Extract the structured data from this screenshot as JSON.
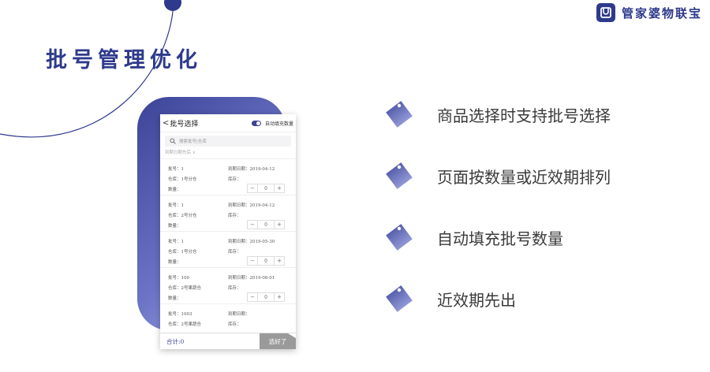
{
  "brand": {
    "name": "管家婆物联宝"
  },
  "slide": {
    "title": "批号管理优化"
  },
  "phone": {
    "header": {
      "back": "<",
      "title": "批号选择",
      "auto_fill_label": "自动填充数量",
      "auto_fill_on": true
    },
    "search": {
      "placeholder": "搜索批号|仓库"
    },
    "sort": {
      "label": "到期日期先后 ∨"
    },
    "items": [
      {
        "batch": "批号：1",
        "warehouse": "仓库：1号分仓",
        "qty_label": "数量：",
        "expiry": "到期日期：2019-04-12",
        "stock": "库存：",
        "qty": "0"
      },
      {
        "batch": "批号：1",
        "warehouse": "仓库：2号分仓",
        "qty_label": "数量：",
        "expiry": "到期日期：2019-04-12",
        "stock": "库存：",
        "qty": "0"
      },
      {
        "batch": "批号：1",
        "warehouse": "仓库：1号分仓",
        "qty_label": "数量：",
        "expiry": "到期日期：2019-05-30",
        "stock": "库存：",
        "qty": "0"
      },
      {
        "batch": "批号：100",
        "warehouse": "仓库：2号果蔬仓",
        "qty_label": "数量：",
        "expiry": "到期日期：2019-06-01",
        "stock": "库存：",
        "qty": "0"
      },
      {
        "batch": "批号：1003",
        "warehouse": "仓库：2号果蔬仓",
        "qty_label": "",
        "expiry": "到期日期：",
        "stock": "库存：",
        "qty": ""
      }
    ],
    "footer": {
      "total": "合计:0",
      "confirm": "选好了"
    }
  },
  "features": [
    {
      "text": "商品选择时支持批号选择",
      "icon": "diamond-tag-icon"
    },
    {
      "text": "页面按数量或近效期排列",
      "icon": "diamond-tag-icon"
    },
    {
      "text": "自动填充批号数量",
      "icon": "diamond-tag-icon"
    },
    {
      "text": "近效期先出",
      "icon": "diamond-tag-icon"
    }
  ],
  "colors": {
    "primary": "#2e3a8c",
    "gradient_start": "#3b4496",
    "gradient_end": "#b3b9ee"
  }
}
